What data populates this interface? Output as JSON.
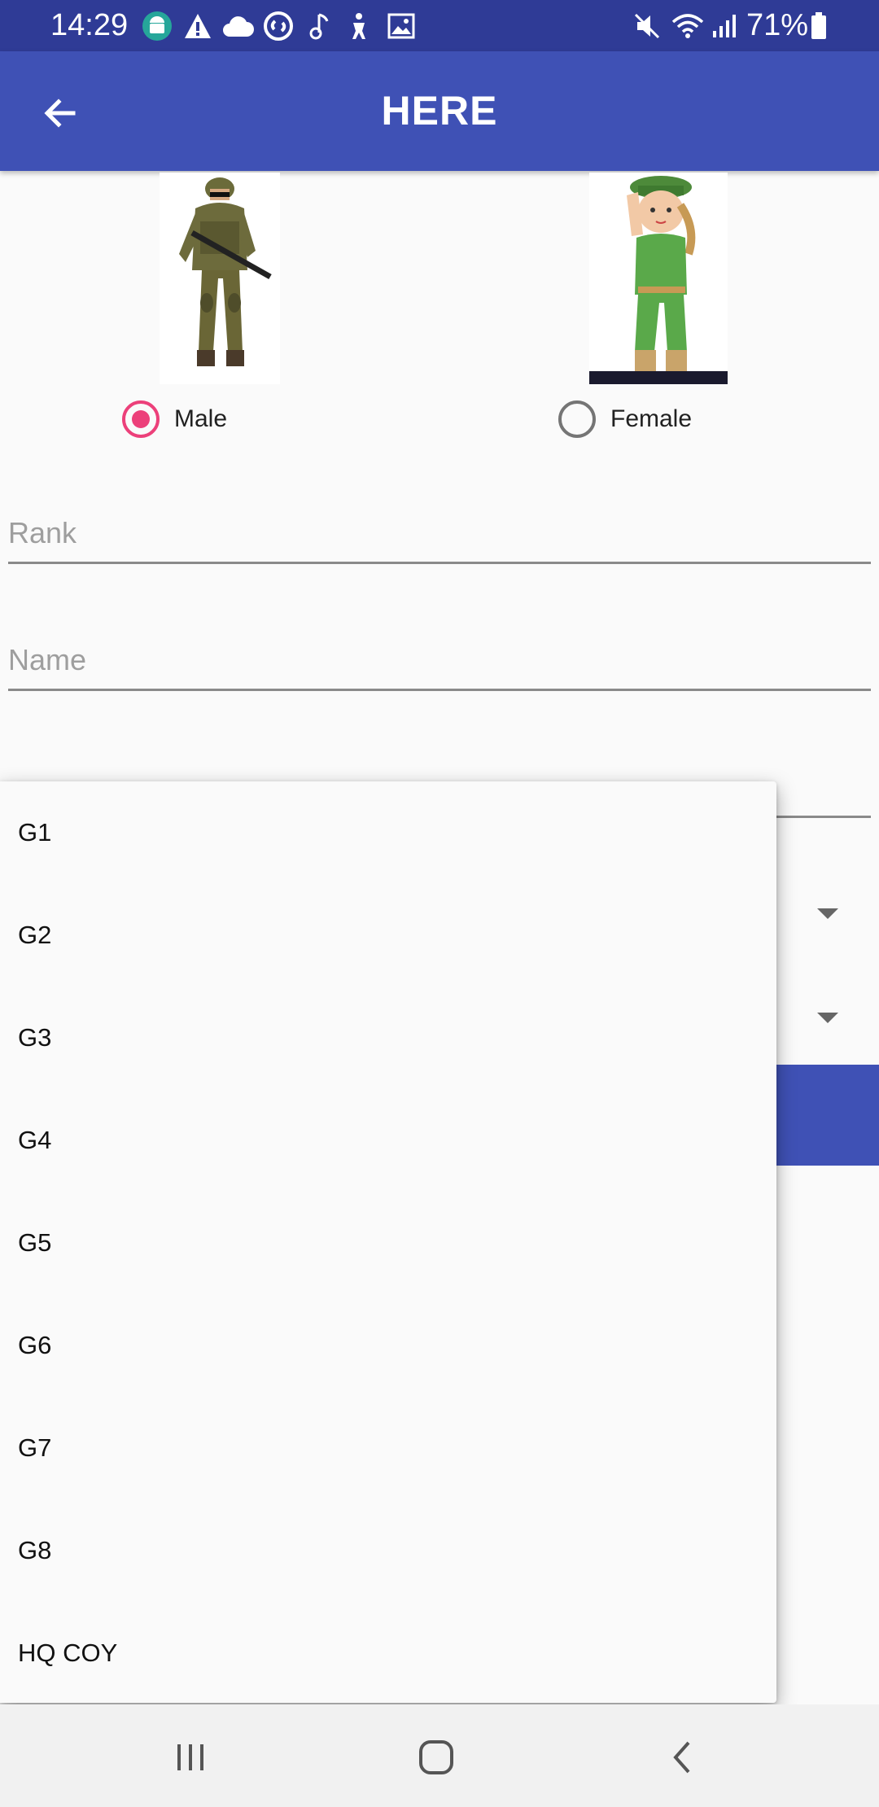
{
  "status_bar": {
    "time": "14:29",
    "battery": "71%",
    "icons": [
      "android-icon",
      "warning-icon",
      "cloud-icon",
      "shazam-icon",
      "music-note-icon",
      "accessibility-icon",
      "image-icon",
      "mute-icon",
      "wifi-icon",
      "signal-icon",
      "battery-icon"
    ]
  },
  "app_bar": {
    "title": "HERE",
    "back_icon": "arrow-left-icon",
    "color": "#3f51b5"
  },
  "gender": {
    "male_label": "Male",
    "female_label": "Female",
    "selected": "Male",
    "accent": "#ec407a"
  },
  "form": {
    "rank_placeholder": "Rank",
    "name_placeholder": "Name"
  },
  "dropdown": {
    "items": [
      "G1",
      "G2",
      "G3",
      "G4",
      "G5",
      "G6",
      "G7",
      "G8",
      "HQ COY"
    ]
  },
  "nav_bar": {
    "icons": [
      "recent-apps-icon",
      "home-icon",
      "back-icon"
    ]
  }
}
